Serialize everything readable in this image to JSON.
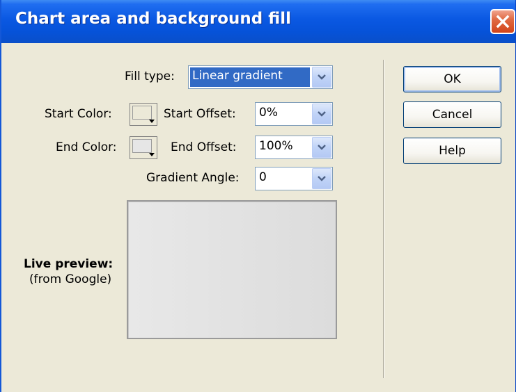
{
  "window": {
    "title": "Chart area and background fill"
  },
  "form": {
    "fill_type": {
      "label": "Fill type:",
      "value": "Linear gradient"
    },
    "start_color": {
      "label": "Start Color:",
      "swatch_color": "#ece9d8"
    },
    "start_offset": {
      "label": "Start Offset:",
      "value": "0%"
    },
    "end_color": {
      "label": "End Color:",
      "swatch_color": "#e6e6e6"
    },
    "end_offset": {
      "label": "End Offset:",
      "value": "100%"
    },
    "gradient_angle": {
      "label": "Gradient Angle:",
      "value": "0"
    }
  },
  "preview": {
    "title": "Live preview:",
    "subtitle": "(from Google)",
    "gradient_start": "#e8e8e8",
    "gradient_end": "#dcdcdc"
  },
  "buttons": {
    "ok": "OK",
    "cancel": "Cancel",
    "help": "Help"
  },
  "colors": {
    "titlebar": "#0a58e2",
    "close": "#d2441a",
    "selection": "#316ac5",
    "dialog_bg": "#ece9d8"
  }
}
